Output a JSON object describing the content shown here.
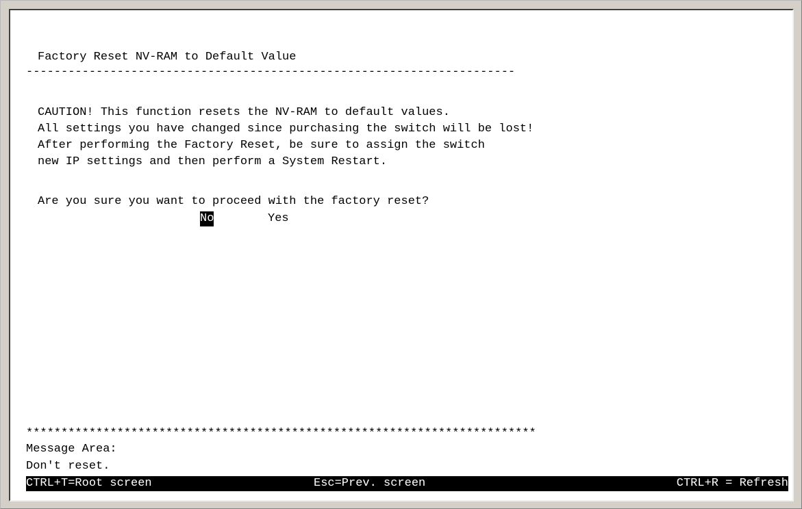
{
  "screen": {
    "title": "Factory Reset NV-RAM to Default Value",
    "top_separator": "----------------------------------------------------------------------",
    "caution_lines": [
      "CAUTION! This function resets the NV-RAM to default values.",
      "All settings you have changed since purchasing the switch will be lost!",
      "After performing the Factory Reset, be sure to assign the switch",
      "new IP settings and then perform a System Restart."
    ],
    "question": "Are you sure you want to proceed with the factory reset?",
    "options": {
      "no": "No",
      "yes": "Yes",
      "selected": "No"
    },
    "bottom_separator": "*************************************************************************",
    "message_area_label": "Message Area:",
    "message": "Don't reset."
  },
  "status_bar": {
    "left": "CTRL+T=Root screen",
    "center": "Esc=Prev. screen",
    "right": "CTRL+R = Refresh"
  }
}
